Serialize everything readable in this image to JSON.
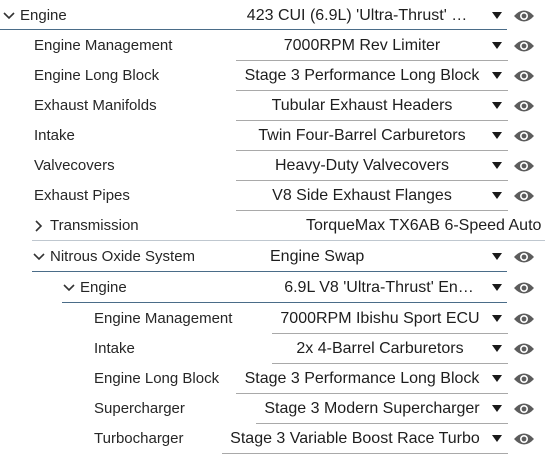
{
  "rows": [
    {
      "label": "Engine",
      "value": "423 CUI (6.9L) 'Ultra-Thrust' …",
      "expanded": true
    },
    {
      "label": "Engine Management",
      "value": "7000RPM Rev Limiter"
    },
    {
      "label": "Engine Long Block",
      "value": "Stage 3 Performance Long Block"
    },
    {
      "label": "Exhaust Manifolds",
      "value": "Tubular Exhaust Headers"
    },
    {
      "label": "Intake",
      "value": "Twin Four-Barrel Carburetors"
    },
    {
      "label": "Valvecovers",
      "value": "Heavy-Duty Valvecovers"
    },
    {
      "label": "Exhaust Pipes",
      "value": "V8 Side Exhaust Flanges"
    },
    {
      "label": "Transmission",
      "value": "TorqueMax TX6AB 6-Speed Auto",
      "expanded": false
    },
    {
      "label": "Nitrous Oxide System",
      "value": "Engine Swap",
      "expanded": true
    },
    {
      "label": "Engine",
      "value": "6.9L V8 'Ultra-Thrust' En…",
      "expanded": true
    },
    {
      "label": "Engine Management",
      "value": "7000RPM Ibishu Sport ECU"
    },
    {
      "label": "Intake",
      "value": "2x 4-Barrel Carburetors"
    },
    {
      "label": "Engine Long Block",
      "value": "Stage 3 Performance Long Block"
    },
    {
      "label": "Supercharger",
      "value": "Stage 3 Modern Supercharger"
    },
    {
      "label": "Turbocharger",
      "value": "Stage 3 Variable Boost Race Turbo"
    }
  ],
  "icons": {
    "expand": "chevron-down-icon",
    "collapse": "chevron-right-icon",
    "dropdown": "caret-down-icon",
    "visibility": "eye-icon"
  },
  "colors": {
    "text": "#262626",
    "icon": "#595959",
    "accent_line": "#4a6c88"
  }
}
